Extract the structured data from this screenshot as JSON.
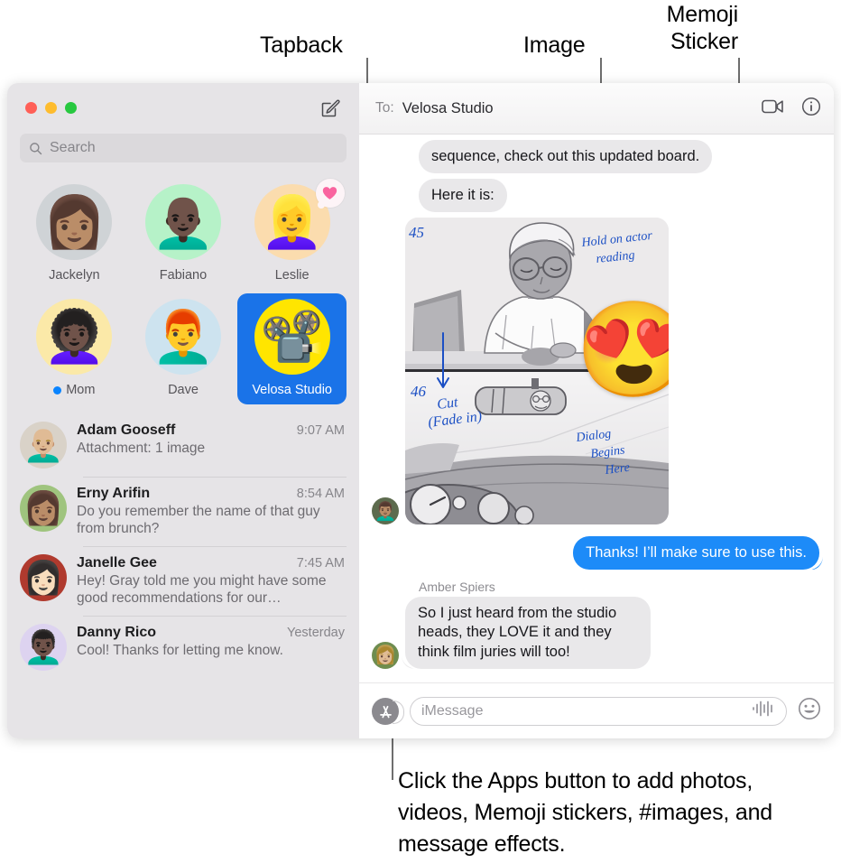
{
  "annotations": {
    "tapback": "Tapback",
    "image": "Image",
    "memoji_sticker": "Memoji\nSticker",
    "caption": "Click the Apps button to add photos, videos, Memoji stickers, #images, and message effects."
  },
  "window": {
    "traffic_lights": {
      "close": "close-button",
      "minimize": "minimize-button",
      "zoom": "zoom-button"
    },
    "compose_icon": "compose-icon"
  },
  "sidebar": {
    "search": {
      "placeholder": "Search",
      "icon": "search-icon"
    },
    "pinned": [
      {
        "name": "Jackelyn",
        "glyph": "👩🏽",
        "bg": "#cfd3d6",
        "selected": false,
        "unread": false,
        "tapback": null
      },
      {
        "name": "Fabiano",
        "glyph": "👨🏿‍🦲",
        "bg": "#b6f2c8",
        "selected": false,
        "unread": false,
        "tapback": null
      },
      {
        "name": "Leslie",
        "glyph": "👱‍♀️",
        "bg": "#fbdcae",
        "selected": false,
        "unread": false,
        "tapback": "❤️"
      },
      {
        "name": "Mom",
        "glyph": "👩🏿‍🦱",
        "bg": "#fbe9a8",
        "selected": false,
        "unread": true,
        "tapback": null
      },
      {
        "name": "Dave",
        "glyph": "👨‍🦰",
        "bg": "#cde3ef",
        "selected": false,
        "unread": false,
        "tapback": null
      },
      {
        "name": "Velosa Studio",
        "glyph": "📽️",
        "bg": "#ffe500",
        "selected": true,
        "unread": false,
        "tapback": null
      }
    ],
    "conversations": [
      {
        "name": "Adam Gooseff",
        "time": "9:07 AM",
        "preview": "Attachment: 1 image",
        "glyph": "👨🏼‍🦲",
        "bg": "#d9d2c8"
      },
      {
        "name": "Erny Arifin",
        "time": "8:54 AM",
        "preview": "Do you remember the name of that guy from brunch?",
        "glyph": "👩🏽",
        "bg": "#9fc47e"
      },
      {
        "name": "Janelle Gee",
        "time": "7:45 AM",
        "preview": "Hey! Gray told me you might have some good recommendations for our…",
        "glyph": "👩🏻",
        "bg": "#b03a2e"
      },
      {
        "name": "Danny Rico",
        "time": "Yesterday",
        "preview": "Cool! Thanks for letting me know.",
        "glyph": "👨🏿‍🦱",
        "bg": "#ddd3f0"
      }
    ]
  },
  "conversation": {
    "to_label": "To:",
    "to_value": "Velosa Studio",
    "facetime_icon": "video-camera-icon",
    "details_icon": "info-icon",
    "messages": [
      {
        "type": "text",
        "direction": "in",
        "text": "sequence, check out this updated board.",
        "tail": false
      },
      {
        "type": "text",
        "direction": "in",
        "text": "Here it is:",
        "tail": false
      },
      {
        "type": "image",
        "direction": "in",
        "alt": "storyboard-image"
      },
      {
        "type": "text",
        "direction": "out",
        "text": "Thanks! I’ll make sure to use this.",
        "tail": true
      },
      {
        "type": "text",
        "direction": "in",
        "sender": "Amber Spiers",
        "text": "So I just heard from the studio heads, they LOVE it and they think film juries will too!",
        "tail": true
      }
    ],
    "storyboard": {
      "panel_top_number": "45",
      "panel_bottom_number": "46",
      "note_top_right": "Hold on actor\nreading",
      "note_cut": "Cut\n(Fade in)",
      "note_dialog": "Dialog\nBegins\nHere",
      "sticker_glyph": "😍"
    }
  },
  "input_bar": {
    "apps_button_label": "apps-button",
    "placeholder": "iMessage",
    "audio_icon": "audio-waveform-icon",
    "emoji_icon": "emoji-icon"
  },
  "colors": {
    "outgoing_bubble": "#1d8bf8",
    "incoming_bubble": "#e9e8ea",
    "selection": "#1a73e8",
    "unread_dot": "#0a84ff",
    "tapback_heart": "#f9649f"
  }
}
